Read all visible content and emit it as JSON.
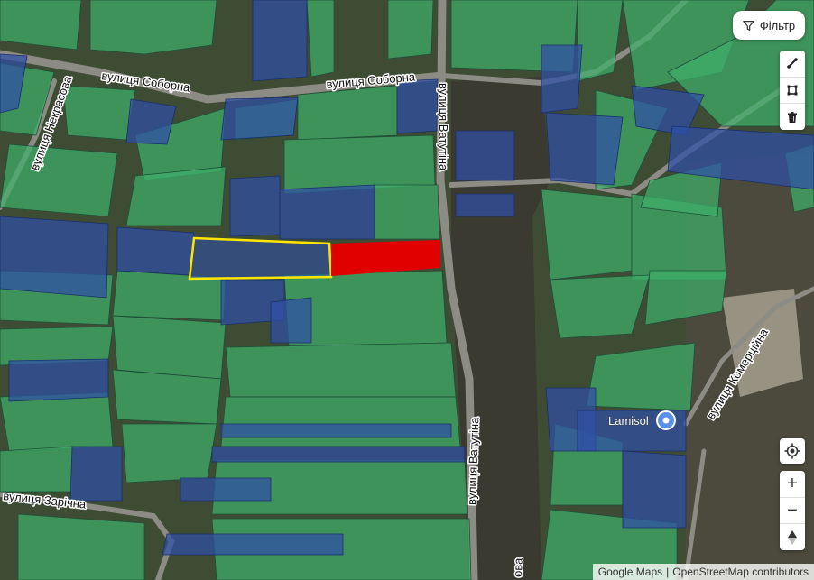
{
  "map": {
    "streets": {
      "soborna_upper": "вулиця Соборна",
      "soborna_lower": "вулиця Соборна",
      "nekrasova": "вулиця Некрасова",
      "vatutina_upper": "вулиця Ватутіна",
      "vatutina_lower": "вулиця Ватутіна",
      "zarichna": "вулиця Зарічна",
      "komertsiyna": "вулиця Комерційна",
      "bottom_partial": "ова"
    },
    "poi": {
      "lamisol": "Lamisol"
    },
    "colors": {
      "parcel_green": "#3fae6a",
      "parcel_blue": "#2f4fa8",
      "selected_fill": "#e00000",
      "highlight_outline": "#ffe600",
      "aerial_base": "#4a5a3a"
    }
  },
  "controls": {
    "filter": {
      "label": "Фільтр",
      "icon": "filter-funnel-icon"
    },
    "tools": [
      {
        "name": "draw-line-tool",
        "icon": "line-draw-icon"
      },
      {
        "name": "draw-rectangle-tool",
        "icon": "square-draw-icon"
      },
      {
        "name": "delete-tool",
        "icon": "trash-icon"
      }
    ],
    "locate": {
      "icon": "crosshair-icon"
    },
    "zoom_in": "+",
    "zoom_out": "−",
    "compass": "north-arrow-icon"
  },
  "attribution": {
    "google": "Google Maps",
    "separator": "|",
    "osm": "OpenStreetMap contributors"
  }
}
